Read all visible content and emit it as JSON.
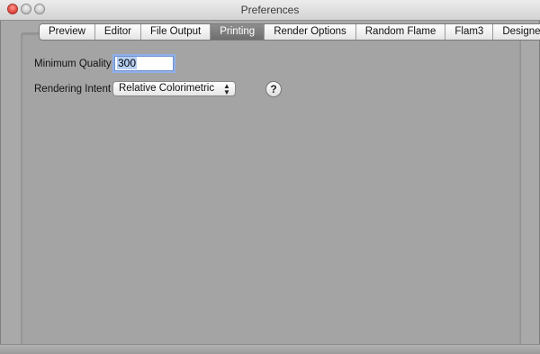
{
  "window": {
    "title": "Preferences"
  },
  "tabs": [
    {
      "label": "Preview",
      "active": false
    },
    {
      "label": "Editor",
      "active": false
    },
    {
      "label": "File Output",
      "active": false
    },
    {
      "label": "Printing",
      "active": true
    },
    {
      "label": "Render Options",
      "active": false
    },
    {
      "label": "Random Flame",
      "active": false
    },
    {
      "label": "Flam3",
      "active": false
    },
    {
      "label": "Designer",
      "active": false
    }
  ],
  "printing": {
    "min_quality_label": "Minimum Quality",
    "min_quality_value": "300",
    "intent_label": "Rendering Intent",
    "intent_value": "Relative Colorimetric",
    "help_label": "?"
  }
}
